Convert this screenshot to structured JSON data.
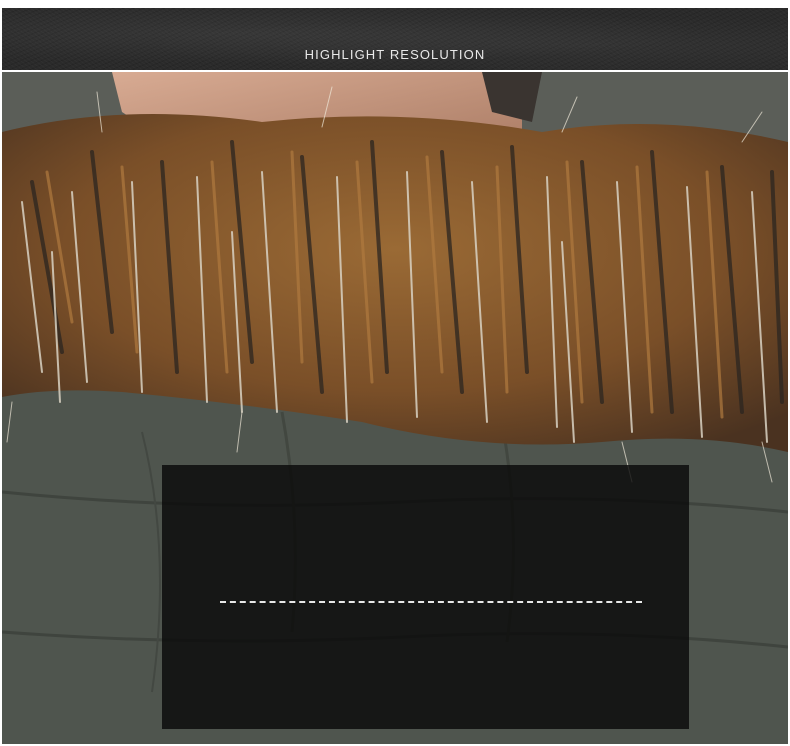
{
  "banner": {
    "title": "HIGHLIGHT RESOLUTION"
  },
  "photo": {
    "subject": "fur-trimmed hood on dark olive puffer jacket",
    "colors": {
      "jacket": "#4f554e",
      "fur_brown": "#8a5a2b",
      "fur_dark": "#2b2520",
      "fur_light": "#d9d2c3",
      "skin": "#c99b82",
      "overlay": "#0a0a0a"
    }
  }
}
